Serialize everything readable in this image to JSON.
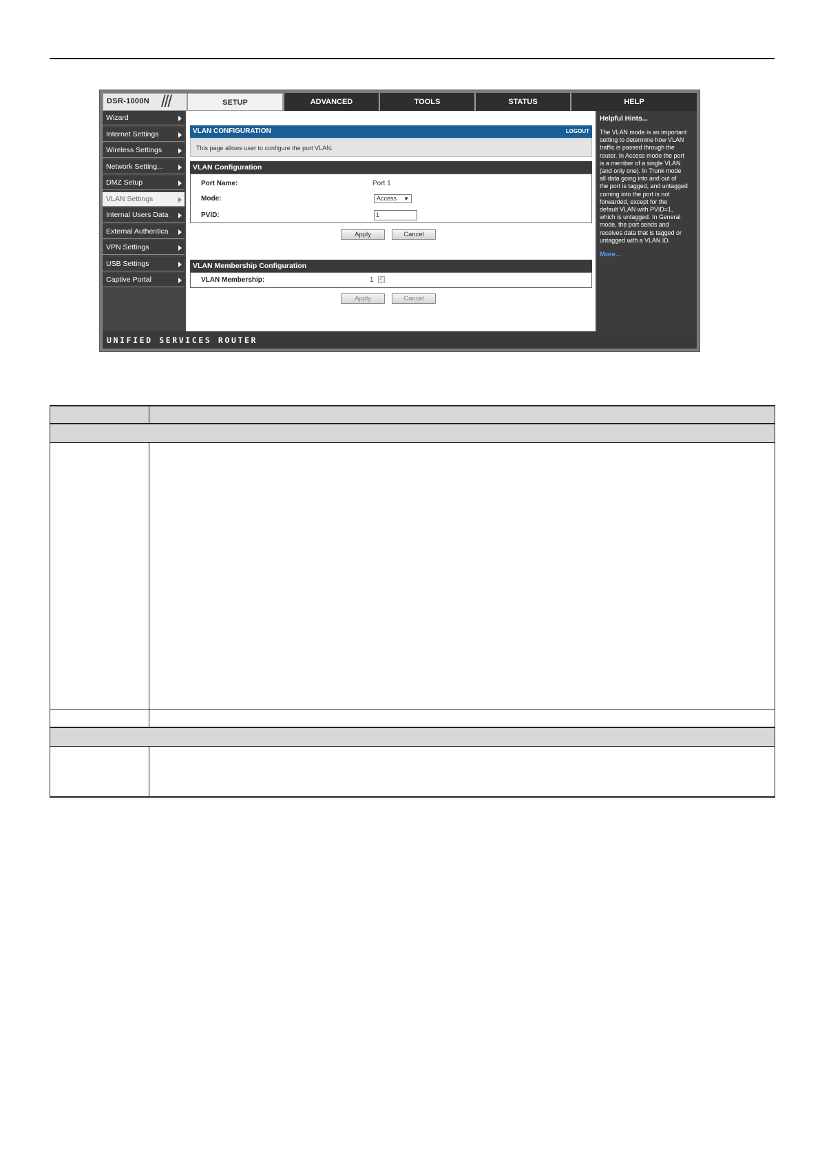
{
  "router": {
    "brand": "DSR-1000N",
    "tabs": [
      {
        "label": "SETUP",
        "active": true
      },
      {
        "label": "ADVANCED",
        "active": false
      },
      {
        "label": "TOOLS",
        "active": false
      },
      {
        "label": "STATUS",
        "active": false
      },
      {
        "label": "HELP",
        "active": false
      }
    ],
    "sidebar": [
      {
        "label": "Wizard",
        "active": false
      },
      {
        "label": "Internet Settings",
        "active": false
      },
      {
        "label": "Wireless Settings",
        "active": false
      },
      {
        "label": "Network Setting...",
        "active": false
      },
      {
        "label": "DMZ Setup",
        "active": false
      },
      {
        "label": "VLAN Settings",
        "active": true
      },
      {
        "label": "Internal Users Data",
        "active": false
      },
      {
        "label": "External Authentica",
        "active": false
      },
      {
        "label": "VPN Settings",
        "active": false
      },
      {
        "label": "USB Settings",
        "active": false
      },
      {
        "label": "Captive Portal",
        "active": false
      }
    ],
    "page_header": {
      "title": "VLAN CONFIGURATION",
      "logout": "LOGOUT"
    },
    "info_text": "This page allows user to configure the port VLAN.",
    "vlan_config": {
      "title": "VLAN Configuration",
      "port_name_label": "Port Name:",
      "port_name_value": "Port 1",
      "mode_label": "Mode:",
      "mode_value": "Access",
      "pvid_label": "PVID:",
      "pvid_value": "1",
      "apply": "Apply",
      "cancel": "Cancel"
    },
    "membership": {
      "title": "VLAN Membership Configuration",
      "label": "VLAN Membership:",
      "value": "1",
      "checked": true,
      "apply": "Apply",
      "cancel": "Cancel"
    },
    "help": {
      "title": "Helpful Hints...",
      "lines": [
        "The VLAN mode is an important",
        "setting to determine how VLAN",
        "traffic is passed through the",
        "router. In Access mode the port",
        "is a member of a single VLAN",
        "(and only one). In Trunk mode",
        "all data going into and out of",
        "the port is tagged, and untagged",
        "coming into the port is not",
        "forwarded, except for the",
        "default VLAN with PVID=1,",
        "which is untagged. In General",
        "mode, the port sends and",
        "receives data that is tagged or",
        "untagged with a VLAN ID."
      ],
      "more": "More..."
    },
    "footer": "UNIFIED SERVICES ROUTER"
  },
  "colors": {
    "header_blue": "#1a5e96",
    "dark_bar": "#3a3a3a",
    "help_link": "#5ea0ff",
    "table_shade": "#d7d7d7"
  }
}
